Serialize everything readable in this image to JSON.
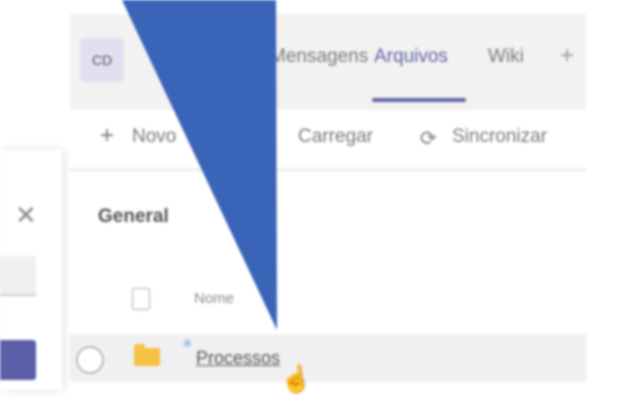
{
  "avatar": {
    "initials": "CD"
  },
  "tabs": [
    {
      "label": "Mensagens"
    },
    {
      "label": "Arquivos",
      "active": true
    },
    {
      "label": "Wiki"
    }
  ],
  "add_tab_icon": "plus-icon",
  "toolbar": {
    "new_label": "Novo",
    "upload_label": "Carregar",
    "sync_label": "Sincronizar",
    "sync_icon": "sync-icon"
  },
  "section": {
    "title": "General"
  },
  "table": {
    "column_name": "Nome",
    "rows": [
      {
        "name": "Processos",
        "type": "folder"
      }
    ]
  },
  "dialog": {
    "close_icon": "close-icon"
  },
  "colors": {
    "accent": "#6264a7",
    "overlay_blue": "#3a64b8",
    "folder": "#f5c242"
  }
}
